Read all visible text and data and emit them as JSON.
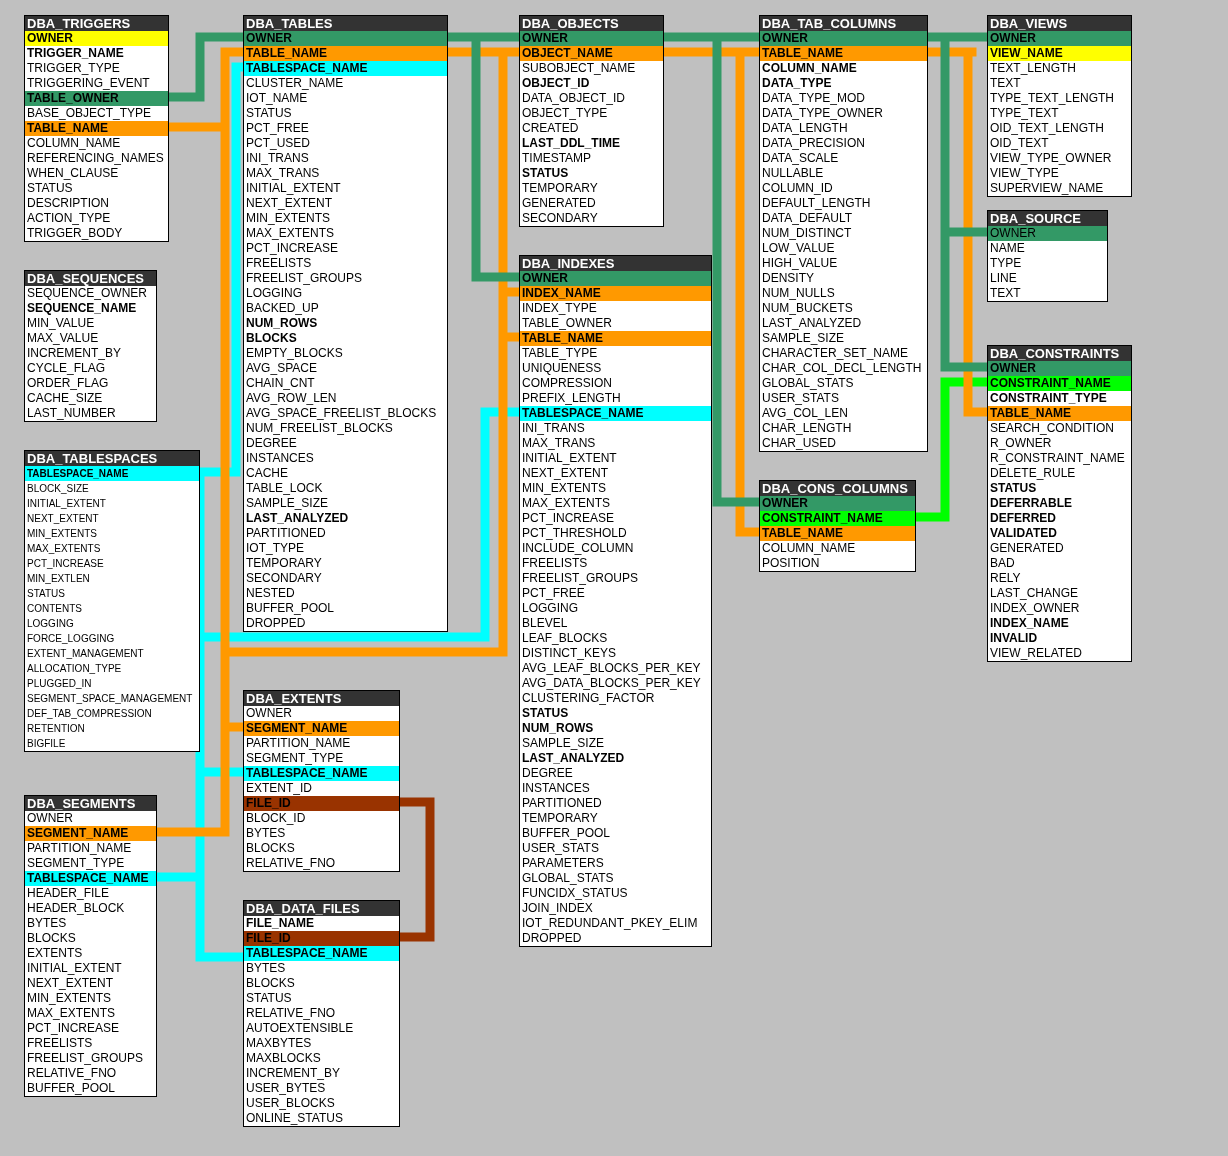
{
  "tables": [
    {
      "name": "DBA_TRIGGERS",
      "columns": [
        {
          "name": "OWNER",
          "bold": true,
          "color": "#ffff00"
        },
        {
          "name": "TRIGGER_NAME",
          "bold": true
        },
        {
          "name": "TRIGGER_TYPE",
          "bold": false
        },
        {
          "name": "TRIGGERING_EVENT",
          "bold": false
        },
        {
          "name": "TABLE_OWNER",
          "bold": true,
          "color": "#339966"
        },
        {
          "name": "BASE_OBJECT_TYPE",
          "bold": false
        },
        {
          "name": "TABLE_NAME",
          "bold": true,
          "color": "#ff9900"
        },
        {
          "name": "COLUMN_NAME",
          "bold": false
        },
        {
          "name": "REFERENCING_NAMES",
          "bold": false
        },
        {
          "name": "WHEN_CLAUSE",
          "bold": false
        },
        {
          "name": "STATUS",
          "bold": false
        },
        {
          "name": "DESCRIPTION",
          "bold": false
        },
        {
          "name": "ACTION_TYPE",
          "bold": false
        },
        {
          "name": "TRIGGER_BODY",
          "bold": false
        }
      ]
    },
    {
      "name": "DBA_SEQUENCES",
      "columns": [
        {
          "name": "SEQUENCE_OWNER",
          "bold": false
        },
        {
          "name": "SEQUENCE_NAME",
          "bold": true
        },
        {
          "name": "MIN_VALUE",
          "bold": false
        },
        {
          "name": "MAX_VALUE",
          "bold": false
        },
        {
          "name": "INCREMENT_BY",
          "bold": false
        },
        {
          "name": "CYCLE_FLAG",
          "bold": false
        },
        {
          "name": "ORDER_FLAG",
          "bold": false
        },
        {
          "name": "CACHE_SIZE",
          "bold": false
        },
        {
          "name": "LAST_NUMBER",
          "bold": false
        }
      ]
    },
    {
      "name": "DBA_TABLESPACES",
      "columns": [
        {
          "name": "TABLESPACE_NAME",
          "bold": true,
          "color": "#00ffff"
        },
        {
          "name": "BLOCK_SIZE",
          "bold": false
        },
        {
          "name": "INITIAL_EXTENT",
          "bold": false
        },
        {
          "name": "NEXT_EXTENT",
          "bold": false
        },
        {
          "name": "MIN_EXTENTS",
          "bold": false
        },
        {
          "name": "MAX_EXTENTS",
          "bold": false
        },
        {
          "name": "PCT_INCREASE",
          "bold": false
        },
        {
          "name": "MIN_EXTLEN",
          "bold": false
        },
        {
          "name": "STATUS",
          "bold": false
        },
        {
          "name": "CONTENTS",
          "bold": false
        },
        {
          "name": "LOGGING",
          "bold": false
        },
        {
          "name": "FORCE_LOGGING",
          "bold": false
        },
        {
          "name": "EXTENT_MANAGEMENT",
          "bold": false
        },
        {
          "name": "ALLOCATION_TYPE",
          "bold": false
        },
        {
          "name": "PLUGGED_IN",
          "bold": false
        },
        {
          "name": "SEGMENT_SPACE_MANAGEMENT",
          "bold": false
        },
        {
          "name": "DEF_TAB_COMPRESSION",
          "bold": false
        },
        {
          "name": "RETENTION",
          "bold": false
        },
        {
          "name": "BIGFILE",
          "bold": false
        }
      ]
    },
    {
      "name": "DBA_SEGMENTS",
      "columns": [
        {
          "name": "OWNER",
          "bold": false
        },
        {
          "name": "SEGMENT_NAME",
          "bold": true,
          "color": "#ff9900"
        },
        {
          "name": "PARTITION_NAME",
          "bold": false
        },
        {
          "name": "SEGMENT_TYPE",
          "bold": false
        },
        {
          "name": "TABLESPACE_NAME",
          "bold": true,
          "color": "#00ffff"
        },
        {
          "name": "HEADER_FILE",
          "bold": false
        },
        {
          "name": "HEADER_BLOCK",
          "bold": false
        },
        {
          "name": "BYTES",
          "bold": false
        },
        {
          "name": "BLOCKS",
          "bold": false
        },
        {
          "name": "EXTENTS",
          "bold": false
        },
        {
          "name": "INITIAL_EXTENT",
          "bold": false
        },
        {
          "name": "NEXT_EXTENT",
          "bold": false
        },
        {
          "name": "MIN_EXTENTS",
          "bold": false
        },
        {
          "name": "MAX_EXTENTS",
          "bold": false
        },
        {
          "name": "PCT_INCREASE",
          "bold": false
        },
        {
          "name": "FREELISTS",
          "bold": false
        },
        {
          "name": "FREELIST_GROUPS",
          "bold": false
        },
        {
          "name": "RELATIVE_FNO",
          "bold": false
        },
        {
          "name": "BUFFER_POOL",
          "bold": false
        }
      ]
    },
    {
      "name": "DBA_TABLES",
      "columns": [
        {
          "name": "OWNER",
          "bold": true,
          "color": "#339966"
        },
        {
          "name": "TABLE_NAME",
          "bold": true,
          "color": "#ff9900"
        },
        {
          "name": "TABLESPACE_NAME",
          "bold": true,
          "color": "#00ffff"
        },
        {
          "name": "CLUSTER_NAME",
          "bold": false
        },
        {
          "name": "IOT_NAME",
          "bold": false
        },
        {
          "name": "STATUS",
          "bold": false
        },
        {
          "name": "PCT_FREE",
          "bold": false
        },
        {
          "name": "PCT_USED",
          "bold": false
        },
        {
          "name": "INI_TRANS",
          "bold": false
        },
        {
          "name": "MAX_TRANS",
          "bold": false
        },
        {
          "name": "INITIAL_EXTENT",
          "bold": false
        },
        {
          "name": "NEXT_EXTENT",
          "bold": false
        },
        {
          "name": "MIN_EXTENTS",
          "bold": false
        },
        {
          "name": "MAX_EXTENTS",
          "bold": false
        },
        {
          "name": "PCT_INCREASE",
          "bold": false
        },
        {
          "name": "FREELISTS",
          "bold": false
        },
        {
          "name": "FREELIST_GROUPS",
          "bold": false
        },
        {
          "name": "LOGGING",
          "bold": false
        },
        {
          "name": "BACKED_UP",
          "bold": false
        },
        {
          "name": "NUM_ROWS",
          "bold": true
        },
        {
          "name": "BLOCKS",
          "bold": true
        },
        {
          "name": "EMPTY_BLOCKS",
          "bold": false
        },
        {
          "name": "AVG_SPACE",
          "bold": false
        },
        {
          "name": "CHAIN_CNT",
          "bold": false
        },
        {
          "name": "AVG_ROW_LEN",
          "bold": false
        },
        {
          "name": "AVG_SPACE_FREELIST_BLOCKS",
          "bold": false
        },
        {
          "name": "NUM_FREELIST_BLOCKS",
          "bold": false
        },
        {
          "name": "DEGREE",
          "bold": false
        },
        {
          "name": "INSTANCES",
          "bold": false
        },
        {
          "name": "CACHE",
          "bold": false
        },
        {
          "name": "TABLE_LOCK",
          "bold": false
        },
        {
          "name": "SAMPLE_SIZE",
          "bold": false
        },
        {
          "name": "LAST_ANALYZED",
          "bold": true
        },
        {
          "name": "PARTITIONED",
          "bold": false
        },
        {
          "name": "IOT_TYPE",
          "bold": false
        },
        {
          "name": "TEMPORARY",
          "bold": false
        },
        {
          "name": "SECONDARY",
          "bold": false
        },
        {
          "name": "NESTED",
          "bold": false
        },
        {
          "name": "BUFFER_POOL",
          "bold": false
        },
        {
          "name": "DROPPED",
          "bold": false
        }
      ]
    },
    {
      "name": "DBA_EXTENTS",
      "columns": [
        {
          "name": "OWNER",
          "bold": false
        },
        {
          "name": "SEGMENT_NAME",
          "bold": true,
          "color": "#ff9900"
        },
        {
          "name": "PARTITION_NAME",
          "bold": false
        },
        {
          "name": "SEGMENT_TYPE",
          "bold": false
        },
        {
          "name": "TABLESPACE_NAME",
          "bold": true,
          "color": "#00ffff"
        },
        {
          "name": "EXTENT_ID",
          "bold": false
        },
        {
          "name": "FILE_ID",
          "bold": true,
          "color": "#993300"
        },
        {
          "name": "BLOCK_ID",
          "bold": false
        },
        {
          "name": "BYTES",
          "bold": false
        },
        {
          "name": "BLOCKS",
          "bold": false
        },
        {
          "name": "RELATIVE_FNO",
          "bold": false
        }
      ]
    },
    {
      "name": "DBA_DATA_FILES",
      "columns": [
        {
          "name": "FILE_NAME",
          "bold": true
        },
        {
          "name": "FILE_ID",
          "bold": true,
          "color": "#993300"
        },
        {
          "name": "TABLESPACE_NAME",
          "bold": true,
          "color": "#00ffff"
        },
        {
          "name": "BYTES",
          "bold": false
        },
        {
          "name": "BLOCKS",
          "bold": false
        },
        {
          "name": "STATUS",
          "bold": false
        },
        {
          "name": "RELATIVE_FNO",
          "bold": false
        },
        {
          "name": "AUTOEXTENSIBLE",
          "bold": false
        },
        {
          "name": "MAXBYTES",
          "bold": false
        },
        {
          "name": "MAXBLOCKS",
          "bold": false
        },
        {
          "name": "INCREMENT_BY",
          "bold": false
        },
        {
          "name": "USER_BYTES",
          "bold": false
        },
        {
          "name": "USER_BLOCKS",
          "bold": false
        },
        {
          "name": "ONLINE_STATUS",
          "bold": false
        }
      ]
    },
    {
      "name": "DBA_OBJECTS",
      "columns": [
        {
          "name": "OWNER",
          "bold": true,
          "color": "#339966"
        },
        {
          "name": "OBJECT_NAME",
          "bold": true,
          "color": "#ff9900"
        },
        {
          "name": "SUBOBJECT_NAME",
          "bold": false
        },
        {
          "name": "OBJECT_ID",
          "bold": true
        },
        {
          "name": "DATA_OBJECT_ID",
          "bold": false
        },
        {
          "name": "OBJECT_TYPE",
          "bold": false
        },
        {
          "name": "CREATED",
          "bold": false
        },
        {
          "name": "LAST_DDL_TIME",
          "bold": true
        },
        {
          "name": "TIMESTAMP",
          "bold": false
        },
        {
          "name": "STATUS",
          "bold": true
        },
        {
          "name": "TEMPORARY",
          "bold": false
        },
        {
          "name": "GENERATED",
          "bold": false
        },
        {
          "name": "SECONDARY",
          "bold": false
        }
      ]
    },
    {
      "name": "DBA_INDEXES",
      "columns": [
        {
          "name": "OWNER",
          "bold": true,
          "color": "#339966"
        },
        {
          "name": "INDEX_NAME",
          "bold": true,
          "color": "#ff9900"
        },
        {
          "name": "INDEX_TYPE",
          "bold": false
        },
        {
          "name": "TABLE_OWNER",
          "bold": false
        },
        {
          "name": "TABLE_NAME",
          "bold": true,
          "color": "#ff9900"
        },
        {
          "name": "TABLE_TYPE",
          "bold": false
        },
        {
          "name": "UNIQUENESS",
          "bold": false
        },
        {
          "name": "COMPRESSION",
          "bold": false
        },
        {
          "name": "PREFIX_LENGTH",
          "bold": false
        },
        {
          "name": "TABLESPACE_NAME",
          "bold": true,
          "color": "#00ffff"
        },
        {
          "name": "INI_TRANS",
          "bold": false
        },
        {
          "name": "MAX_TRANS",
          "bold": false
        },
        {
          "name": "INITIAL_EXTENT",
          "bold": false
        },
        {
          "name": "NEXT_EXTENT",
          "bold": false
        },
        {
          "name": "MIN_EXTENTS",
          "bold": false
        },
        {
          "name": "MAX_EXTENTS",
          "bold": false
        },
        {
          "name": "PCT_INCREASE",
          "bold": false
        },
        {
          "name": "PCT_THRESHOLD",
          "bold": false
        },
        {
          "name": "INCLUDE_COLUMN",
          "bold": false
        },
        {
          "name": "FREELISTS",
          "bold": false
        },
        {
          "name": "FREELIST_GROUPS",
          "bold": false
        },
        {
          "name": "PCT_FREE",
          "bold": false
        },
        {
          "name": "LOGGING",
          "bold": false
        },
        {
          "name": "BLEVEL",
          "bold": false
        },
        {
          "name": "LEAF_BLOCKS",
          "bold": false
        },
        {
          "name": "DISTINCT_KEYS",
          "bold": false
        },
        {
          "name": "AVG_LEAF_BLOCKS_PER_KEY",
          "bold": false
        },
        {
          "name": "AVG_DATA_BLOCKS_PER_KEY",
          "bold": false
        },
        {
          "name": "CLUSTERING_FACTOR",
          "bold": false
        },
        {
          "name": "STATUS",
          "bold": true
        },
        {
          "name": "NUM_ROWS",
          "bold": true
        },
        {
          "name": "SAMPLE_SIZE",
          "bold": false
        },
        {
          "name": "LAST_ANALYZED",
          "bold": true
        },
        {
          "name": "DEGREE",
          "bold": false
        },
        {
          "name": "INSTANCES",
          "bold": false
        },
        {
          "name": "PARTITIONED",
          "bold": false
        },
        {
          "name": "TEMPORARY",
          "bold": false
        },
        {
          "name": "BUFFER_POOL",
          "bold": false
        },
        {
          "name": "USER_STATS",
          "bold": false
        },
        {
          "name": "PARAMETERS",
          "bold": false
        },
        {
          "name": "GLOBAL_STATS",
          "bold": false
        },
        {
          "name": "FUNCIDX_STATUS",
          "bold": false
        },
        {
          "name": "JOIN_INDEX",
          "bold": false
        },
        {
          "name": "IOT_REDUNDANT_PKEY_ELIM",
          "bold": false
        },
        {
          "name": "DROPPED",
          "bold": false
        }
      ]
    },
    {
      "name": "DBA_TAB_COLUMNS",
      "columns": [
        {
          "name": "OWNER",
          "bold": true,
          "color": "#339966"
        },
        {
          "name": "TABLE_NAME",
          "bold": true,
          "color": "#ff9900"
        },
        {
          "name": "COLUMN_NAME",
          "bold": true
        },
        {
          "name": "DATA_TYPE",
          "bold": true
        },
        {
          "name": "DATA_TYPE_MOD",
          "bold": false
        },
        {
          "name": "DATA_TYPE_OWNER",
          "bold": false
        },
        {
          "name": "DATA_LENGTH",
          "bold": false
        },
        {
          "name": "DATA_PRECISION",
          "bold": false
        },
        {
          "name": "DATA_SCALE",
          "bold": false
        },
        {
          "name": "NULLABLE",
          "bold": false
        },
        {
          "name": "COLUMN_ID",
          "bold": false
        },
        {
          "name": "DEFAULT_LENGTH",
          "bold": false
        },
        {
          "name": "DATA_DEFAULT",
          "bold": false
        },
        {
          "name": "NUM_DISTINCT",
          "bold": false
        },
        {
          "name": "LOW_VALUE",
          "bold": false
        },
        {
          "name": "HIGH_VALUE",
          "bold": false
        },
        {
          "name": "DENSITY",
          "bold": false
        },
        {
          "name": "NUM_NULLS",
          "bold": false
        },
        {
          "name": "NUM_BUCKETS",
          "bold": false
        },
        {
          "name": "LAST_ANALYZED",
          "bold": false
        },
        {
          "name": "SAMPLE_SIZE",
          "bold": false
        },
        {
          "name": "CHARACTER_SET_NAME",
          "bold": false
        },
        {
          "name": "CHAR_COL_DECL_LENGTH",
          "bold": false
        },
        {
          "name": "GLOBAL_STATS",
          "bold": false
        },
        {
          "name": "USER_STATS",
          "bold": false
        },
        {
          "name": "AVG_COL_LEN",
          "bold": false
        },
        {
          "name": "CHAR_LENGTH",
          "bold": false
        },
        {
          "name": "CHAR_USED",
          "bold": false
        }
      ]
    },
    {
      "name": "DBA_CONS_COLUMNS",
      "columns": [
        {
          "name": "OWNER",
          "bold": true,
          "color": "#339966"
        },
        {
          "name": "CONSTRAINT_NAME",
          "bold": true,
          "color": "#00ff00"
        },
        {
          "name": "TABLE_NAME",
          "bold": true,
          "color": "#ff9900"
        },
        {
          "name": "COLUMN_NAME",
          "bold": false
        },
        {
          "name": "POSITION",
          "bold": false
        }
      ]
    },
    {
      "name": "DBA_VIEWS",
      "columns": [
        {
          "name": "OWNER",
          "bold": true,
          "color": "#339966"
        },
        {
          "name": "VIEW_NAME",
          "bold": true,
          "color": "#ffff00"
        },
        {
          "name": "TEXT_LENGTH",
          "bold": false
        },
        {
          "name": "TEXT",
          "bold": false
        },
        {
          "name": "TYPE_TEXT_LENGTH",
          "bold": false
        },
        {
          "name": "TYPE_TEXT",
          "bold": false
        },
        {
          "name": "OID_TEXT_LENGTH",
          "bold": false
        },
        {
          "name": "OID_TEXT",
          "bold": false
        },
        {
          "name": "VIEW_TYPE_OWNER",
          "bold": false
        },
        {
          "name": "VIEW_TYPE",
          "bold": false
        },
        {
          "name": "SUPERVIEW_NAME",
          "bold": false
        }
      ]
    },
    {
      "name": "DBA_SOURCE",
      "columns": [
        {
          "name": "OWNER",
          "bold": false,
          "color": "#339966"
        },
        {
          "name": "NAME",
          "bold": false
        },
        {
          "name": "TYPE",
          "bold": false
        },
        {
          "name": "LINE",
          "bold": false
        },
        {
          "name": "TEXT",
          "bold": false
        }
      ]
    },
    {
      "name": "DBA_CONSTRAINTS",
      "columns": [
        {
          "name": "OWNER",
          "bold": true,
          "color": "#339966"
        },
        {
          "name": "CONSTRAINT_NAME",
          "bold": true,
          "color": "#00ff00"
        },
        {
          "name": "CONSTRAINT_TYPE",
          "bold": true
        },
        {
          "name": "TABLE_NAME",
          "bold": true,
          "color": "#ff9900"
        },
        {
          "name": "SEARCH_CONDITION",
          "bold": false
        },
        {
          "name": "R_OWNER",
          "bold": false
        },
        {
          "name": "R_CONSTRAINT_NAME",
          "bold": false
        },
        {
          "name": "DELETE_RULE",
          "bold": false
        },
        {
          "name": "STATUS",
          "bold": true
        },
        {
          "name": "DEFERRABLE",
          "bold": true
        },
        {
          "name": "DEFERRED",
          "bold": true
        },
        {
          "name": "VALIDATED",
          "bold": true
        },
        {
          "name": "GENERATED",
          "bold": false
        },
        {
          "name": "BAD",
          "bold": false
        },
        {
          "name": "RELY",
          "bold": false
        },
        {
          "name": "LAST_CHANGE",
          "bold": false
        },
        {
          "name": "INDEX_OWNER",
          "bold": false
        },
        {
          "name": "INDEX_NAME",
          "bold": true
        },
        {
          "name": "INVALID",
          "bold": true
        },
        {
          "name": "VIEW_RELATED",
          "bold": false
        }
      ]
    }
  ],
  "connectors": [
    {
      "color": "#00ff00"
    },
    {
      "color": "#993300"
    },
    {
      "color": "#00ffff"
    },
    {
      "color": "#ff9900"
    },
    {
      "color": "#339966"
    }
  ]
}
